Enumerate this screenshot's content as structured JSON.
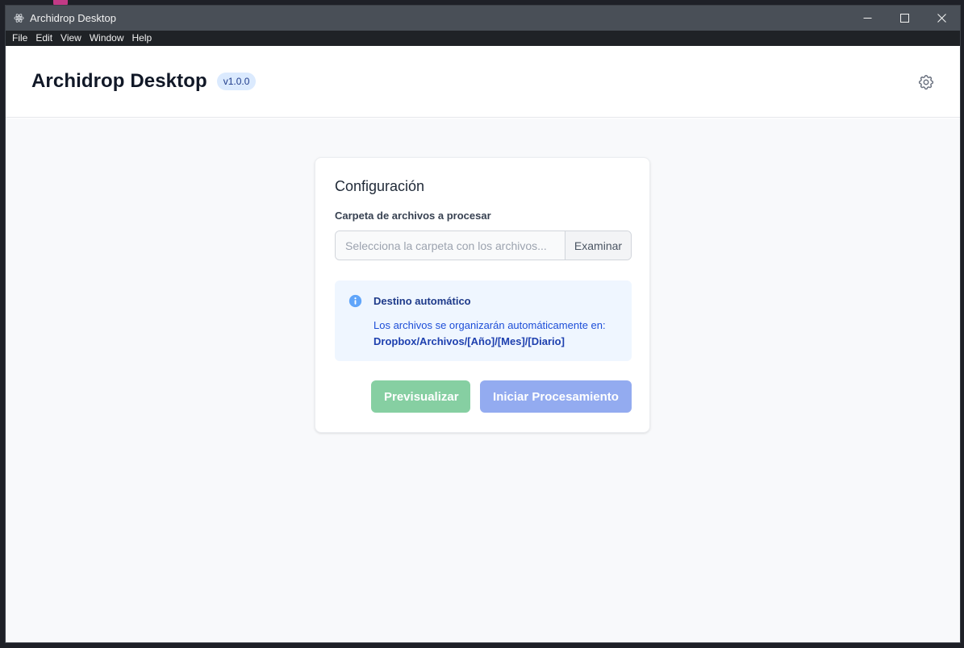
{
  "window": {
    "title": "Archidrop Desktop"
  },
  "menu": [
    "File",
    "Edit",
    "View",
    "Window",
    "Help"
  ],
  "header": {
    "title": "Archidrop Desktop",
    "version": "v1.0.0"
  },
  "config": {
    "title": "Configuración",
    "folder_label": "Carpeta de archivos a procesar",
    "folder_placeholder": "Selecciona la carpeta con los archivos...",
    "folder_value": "",
    "browse_label": "Examinar"
  },
  "info": {
    "title": "Destino automático",
    "text": "Los archivos se organizarán automáticamente en:",
    "path": "Dropbox/Archivos/[Año]/[Mes]/[Diario]"
  },
  "actions": {
    "preview_label": "Previsualizar",
    "start_label": "Iniciar Procesamiento"
  },
  "colors": {
    "accent": "#2563eb",
    "preview_button": "#86cfa2",
    "start_button": "#93abf0",
    "info_bg": "#eff6ff"
  }
}
